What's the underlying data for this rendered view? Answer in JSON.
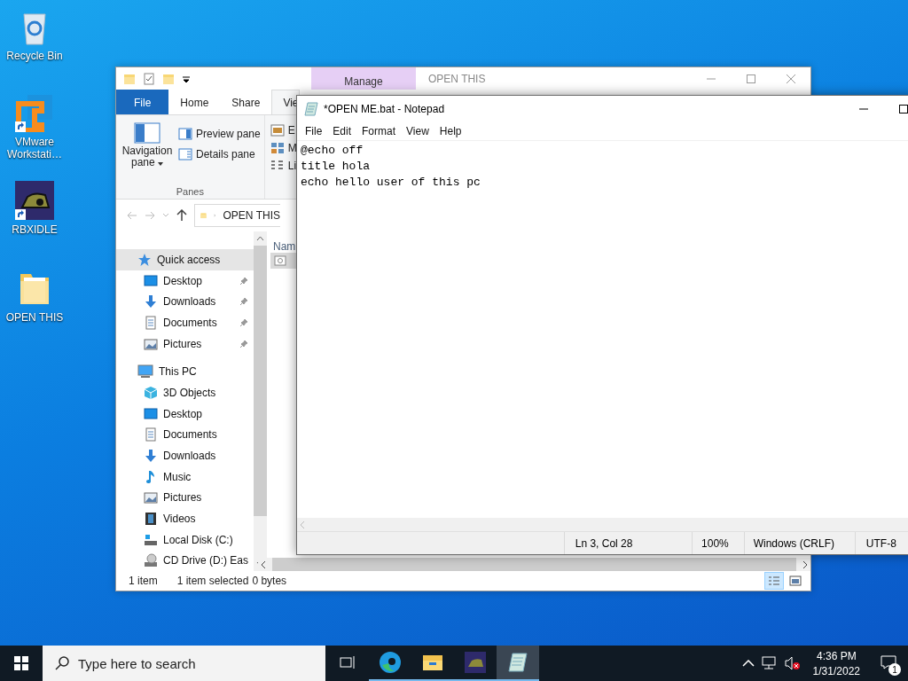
{
  "desktop_icons": [
    {
      "label": "Recycle Bin",
      "kind": "recycle",
      "shortcut": false
    },
    {
      "label": "VMware Workstati…",
      "kind": "vmware",
      "shortcut": true
    },
    {
      "label": "RBXIDLE",
      "kind": "game",
      "shortcut": true
    },
    {
      "label": "OPEN THIS",
      "kind": "folder",
      "shortcut": false
    }
  ],
  "explorer": {
    "title": "OPEN THIS",
    "contextual_tab": "Manage",
    "ribbon_tabs": [
      {
        "label": "File",
        "kind": "file",
        "selected": false
      },
      {
        "label": "Home",
        "kind": "tab",
        "selected": false
      },
      {
        "label": "Share",
        "kind": "tab",
        "selected": false
      },
      {
        "label": "Vie",
        "kind": "tab",
        "selected": true
      }
    ],
    "panes_group": {
      "label": "Panes",
      "navigation_pane": "Navigation pane",
      "items": [
        {
          "label": "Preview pane",
          "kind": "preview"
        },
        {
          "label": "Details pane",
          "kind": "details"
        }
      ]
    },
    "layout_group": {
      "items": [
        {
          "label": "E",
          "kind": "extra"
        },
        {
          "label": "M",
          "kind": "medium"
        },
        {
          "label": "Li",
          "kind": "list"
        }
      ]
    },
    "address": {
      "path": "OPEN THIS"
    },
    "nav": {
      "items": [
        {
          "label": "Quick access",
          "kind": "star",
          "selected": true,
          "children": [
            {
              "label": "Desktop",
              "kind": "desktop",
              "pinned": true,
              "selected": false
            },
            {
              "label": "Downloads",
              "kind": "downloads",
              "pinned": true,
              "selected": false
            },
            {
              "label": "Documents",
              "kind": "documents",
              "pinned": true,
              "selected": false
            },
            {
              "label": "Pictures",
              "kind": "pictures",
              "pinned": true,
              "selected": false
            }
          ]
        },
        {
          "label": "This PC",
          "kind": "pc",
          "selected": false,
          "children": [
            {
              "label": "3D Objects",
              "kind": "objects",
              "pinned": false,
              "selected": false
            },
            {
              "label": "Desktop",
              "kind": "desktop",
              "pinned": false,
              "selected": false
            },
            {
              "label": "Documents",
              "kind": "documents",
              "pinned": false,
              "selected": false
            },
            {
              "label": "Downloads",
              "kind": "downloads",
              "pinned": false,
              "selected": false
            },
            {
              "label": "Music",
              "kind": "music",
              "pinned": false,
              "selected": false
            },
            {
              "label": "Pictures",
              "kind": "pictures",
              "pinned": false,
              "selected": false
            },
            {
              "label": "Videos",
              "kind": "videos",
              "pinned": false,
              "selected": false
            },
            {
              "label": "Local Disk (C:)",
              "kind": "disk",
              "pinned": false,
              "selected": false
            },
            {
              "label": "CD Drive (D:) Eas",
              "kind": "cd",
              "pinned": false,
              "selected": false
            }
          ]
        }
      ]
    },
    "content": {
      "column": "Nam",
      "items": [
        {
          "selected": true
        }
      ]
    },
    "status": {
      "count": "1 item",
      "selection": "1 item selected",
      "size": "0 bytes",
      "views": [
        {
          "kind": "details",
          "selected": true
        },
        {
          "kind": "tiles",
          "selected": false
        }
      ]
    }
  },
  "notepad": {
    "title": "*OPEN ME.bat - Notepad",
    "menu": [
      "File",
      "Edit",
      "Format",
      "View",
      "Help"
    ],
    "lines": [
      "@echo off",
      "title hola",
      "echo hello user of this pc"
    ],
    "status": [
      "Ln 3, Col 28",
      "100%",
      "Windows (CRLF)",
      "UTF-8"
    ]
  },
  "taskbar": {
    "search": {
      "placeholder": "Type here to search"
    },
    "apps": [
      {
        "kind": "taskview",
        "running": false,
        "selected": false
      },
      {
        "kind": "edge",
        "running": true,
        "selected": false
      },
      {
        "kind": "explorer",
        "running": true,
        "selected": false
      },
      {
        "kind": "game",
        "running": true,
        "selected": false
      },
      {
        "kind": "notepad",
        "running": true,
        "selected": true
      }
    ],
    "volume": {
      "muted": true
    },
    "clock": {
      "time": "4:36 PM",
      "date": "1/31/2022"
    },
    "notifications": "1"
  }
}
